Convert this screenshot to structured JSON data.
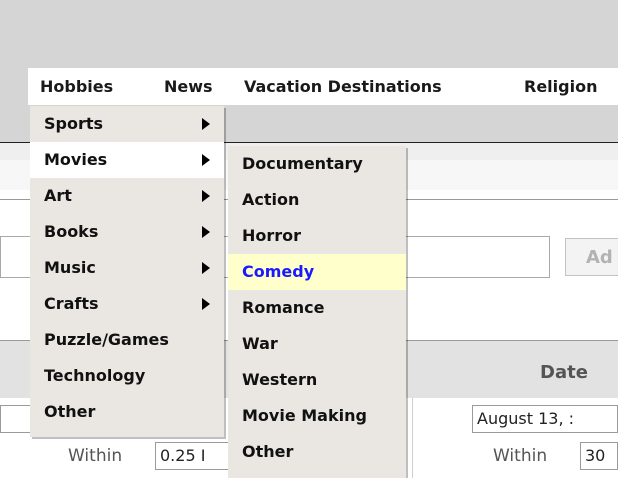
{
  "menubar": {
    "items": [
      {
        "label": "Hobbies"
      },
      {
        "label": "News"
      },
      {
        "label": "Vacation Destinations"
      },
      {
        "label": "Religion"
      }
    ]
  },
  "hobbies_menu": {
    "items": [
      {
        "label": "Sports",
        "has_submenu": true
      },
      {
        "label": "Movies",
        "has_submenu": true
      },
      {
        "label": "Art",
        "has_submenu": true
      },
      {
        "label": "Books",
        "has_submenu": true
      },
      {
        "label": "Music",
        "has_submenu": true
      },
      {
        "label": "Crafts",
        "has_submenu": true
      },
      {
        "label": "Puzzle/Games",
        "has_submenu": false
      },
      {
        "label": "Technology",
        "has_submenu": false
      },
      {
        "label": "Other",
        "has_submenu": false
      }
    ],
    "selected": "Movies"
  },
  "movies_submenu": {
    "items": [
      {
        "label": "Documentary"
      },
      {
        "label": "Action"
      },
      {
        "label": "Horror"
      },
      {
        "label": "Comedy"
      },
      {
        "label": "Romance"
      },
      {
        "label": "War"
      },
      {
        "label": "Western"
      },
      {
        "label": "Movie Making"
      },
      {
        "label": "Other"
      }
    ],
    "highlighted": "Comedy"
  },
  "add_button": {
    "label": "Ad"
  },
  "table_header": {
    "date_label": "Date"
  },
  "distance": {
    "within_label": "Within",
    "value": "0.25 I"
  },
  "date_filter": {
    "date_value": "August 13, :",
    "within_label": "Within",
    "within_value": "30"
  },
  "colors": {
    "highlight_bg": "#ffffcc",
    "highlight_text": "#1a1aff",
    "menu_bg": "#eae7e3"
  }
}
